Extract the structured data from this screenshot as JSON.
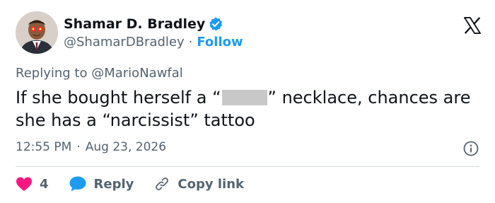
{
  "author": {
    "name": "Shamar D. Bradley",
    "handle": "@ShamarDBradley",
    "separator": "·",
    "follow_label": "Follow"
  },
  "reply": {
    "prefix": "Replying to",
    "mention": "@MarioNawfal"
  },
  "tweet": {
    "text_before": "If she bought herself a “",
    "text_after": "” necklace, chances are she has a “narcissist” tattoo"
  },
  "meta": {
    "time": "12:55 PM",
    "separator": "·",
    "date": "Aug 23, 2026"
  },
  "actions": {
    "like_count": "4",
    "reply_label": "Reply",
    "copy_label": "Copy link"
  },
  "colors": {
    "accent": "#1d9bf0",
    "like": "#f91880",
    "text": "#0f1419",
    "muted": "#536471"
  }
}
